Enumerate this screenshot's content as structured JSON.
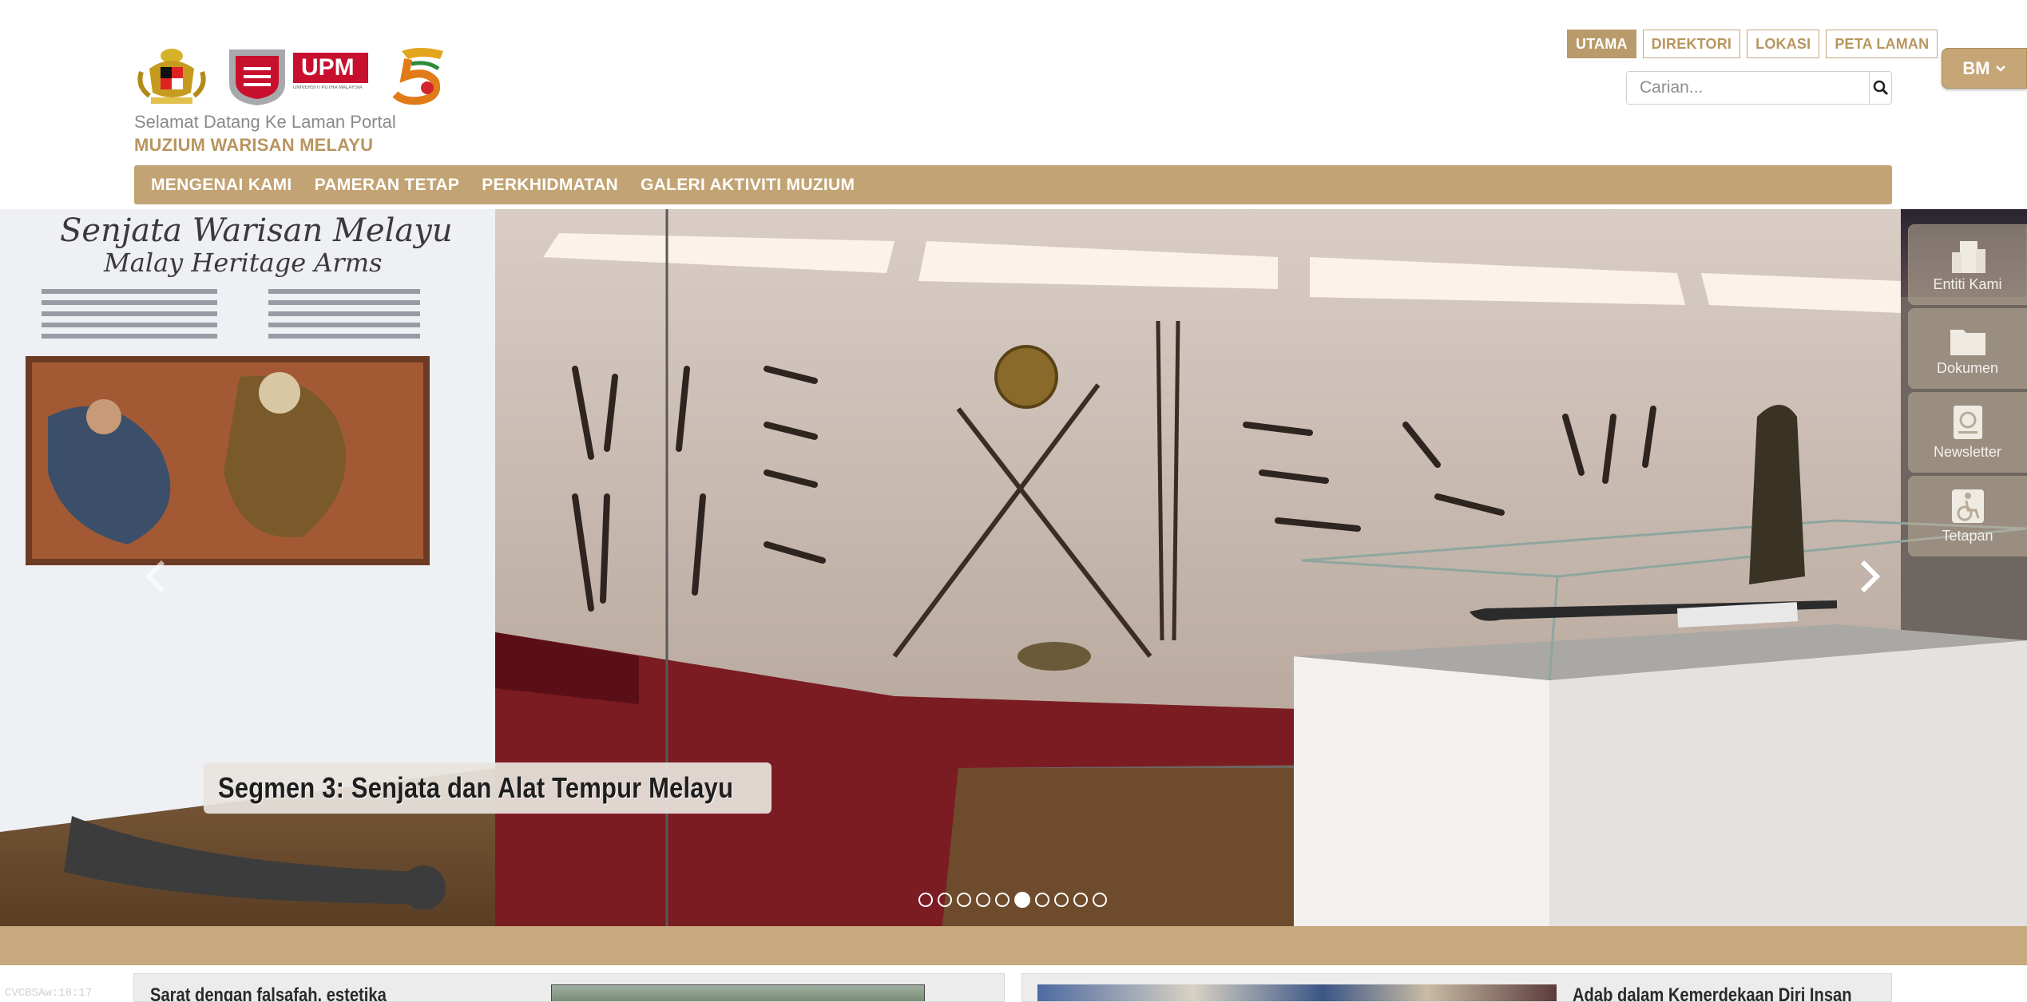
{
  "header": {
    "welcome_text": "Selamat Datang Ke Laman Portal",
    "museum_name": "MUZIUM WARISAN MELAYU",
    "logos": [
      "coat-of-arms",
      "upm-logo",
      "50-anniversary-logo"
    ],
    "upm_logo_text": "UPM",
    "upm_logo_subtext": "UNIVERSITI PUTRA MALAYSIA"
  },
  "toplinks": [
    {
      "label": "UTAMA",
      "active": true
    },
    {
      "label": "DIREKTORI",
      "active": false
    },
    {
      "label": "LOKASI",
      "active": false
    },
    {
      "label": "PETA LAMAN",
      "active": false
    }
  ],
  "search": {
    "placeholder": "Carian...",
    "icon": "search-icon"
  },
  "language": {
    "label": "BM"
  },
  "nav": [
    {
      "label": "MENGENAI KAMI"
    },
    {
      "label": "PAMERAN TETAP"
    },
    {
      "label": "PERKHIDMATAN"
    },
    {
      "label": "GALERI AKTIVITI MUZIUM"
    }
  ],
  "carousel": {
    "caption": "Segmen 3: Senjata dan Alat Tempur Melayu",
    "poster_title": "Senjata Warisan Melayu",
    "poster_subtitle": "Malay Heritage Arms",
    "slide_count": 10,
    "active_slide": 6
  },
  "sidepanel": [
    {
      "label": "Entiti Kami",
      "icon": "building-icon"
    },
    {
      "label": "Dokumen",
      "icon": "folder-icon"
    },
    {
      "label": "Newsletter",
      "icon": "newsletter-icon"
    },
    {
      "label": "Tetapan",
      "icon": "accessibility-icon"
    }
  ],
  "cards": [
    {
      "title": "Sarat dengan falsafah, estetika"
    },
    {
      "title": "Adab dalam Kemerdekaan Diri Insan"
    }
  ],
  "watermark": "CVCBSAw:18:17",
  "colors": {
    "accent": "#c2a373",
    "accent_text": "#b9955f",
    "band": "#c6a97c"
  }
}
